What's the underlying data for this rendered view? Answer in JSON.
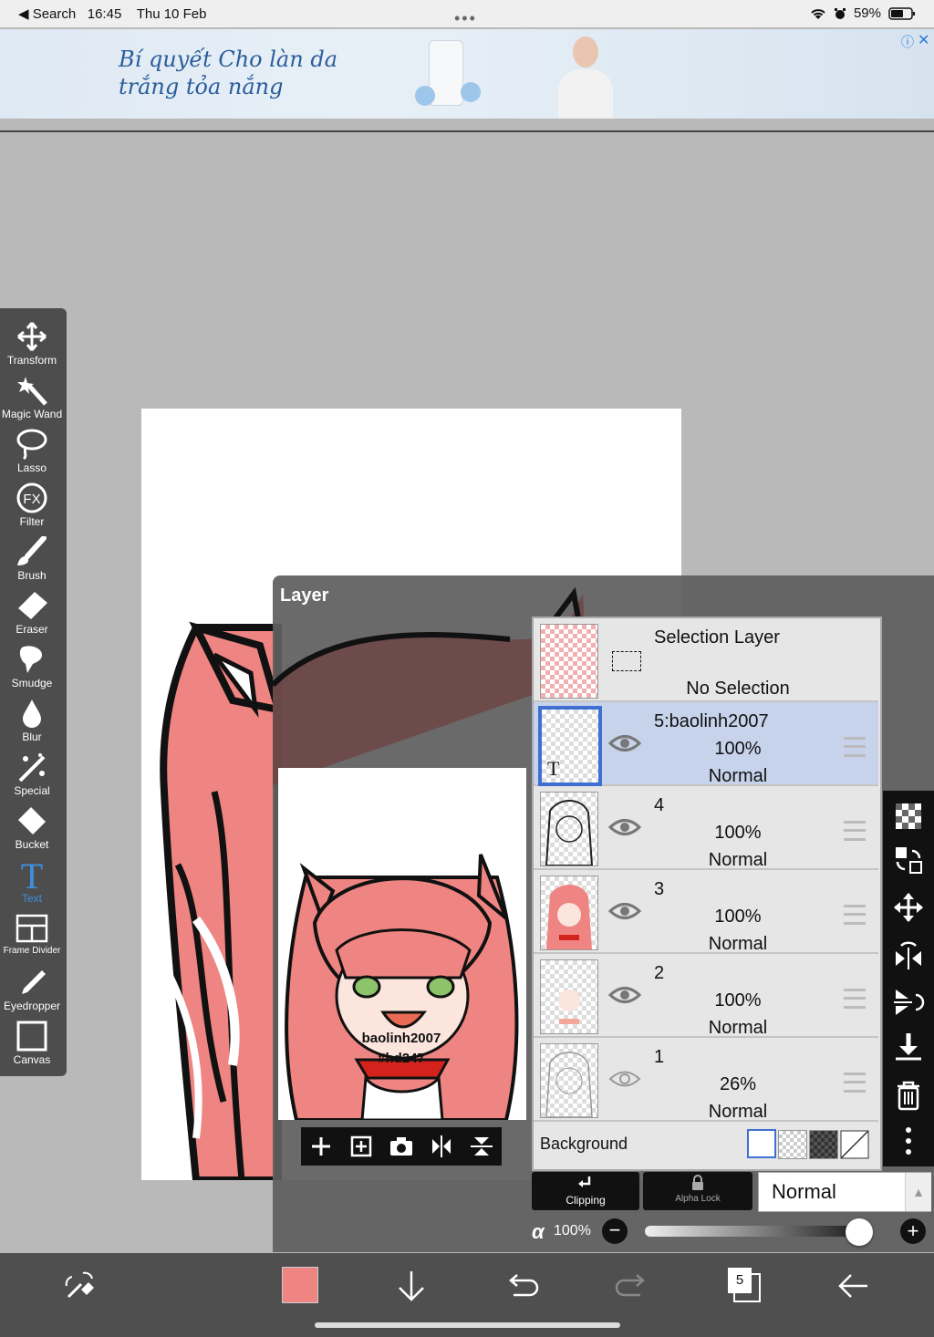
{
  "status_bar": {
    "back_label": "◀ Search",
    "time": "16:45",
    "date": "Thu 10 Feb",
    "battery": "59%"
  },
  "ad": {
    "text": "Bí quyết Cho làn da trắng tỏa nắng"
  },
  "tools": [
    {
      "label": "Transform",
      "icon": "transform-icon"
    },
    {
      "label": "Magic Wand",
      "icon": "magic-wand-icon"
    },
    {
      "label": "Lasso",
      "icon": "lasso-icon"
    },
    {
      "label": "Filter",
      "icon": "filter-icon"
    },
    {
      "label": "Brush",
      "icon": "brush-icon"
    },
    {
      "label": "Eraser",
      "icon": "eraser-icon"
    },
    {
      "label": "Smudge",
      "icon": "smudge-icon"
    },
    {
      "label": "Blur",
      "icon": "blur-icon"
    },
    {
      "label": "Special",
      "icon": "special-icon"
    },
    {
      "label": "Bucket",
      "icon": "bucket-icon"
    },
    {
      "label": "Text",
      "icon": "text-icon",
      "active": true
    },
    {
      "label": "Frame Divider",
      "icon": "frame-divider-icon"
    },
    {
      "label": "Eyedropper",
      "icon": "eyedropper-icon"
    },
    {
      "label": "Canvas",
      "icon": "canvas-icon"
    }
  ],
  "layer_panel": {
    "title": "Layer",
    "watermark_line1": "baolinh2007",
    "watermark_line2": "#hd247",
    "selection_layer": {
      "name": "Selection Layer",
      "status": "No Selection"
    },
    "layers": [
      {
        "name": "5:baolinh2007",
        "opacity": "100%",
        "mode": "Normal",
        "selected": true,
        "visible": true
      },
      {
        "name": "4",
        "opacity": "100%",
        "mode": "Normal",
        "selected": false,
        "visible": true
      },
      {
        "name": "3",
        "opacity": "100%",
        "mode": "Normal",
        "selected": false,
        "visible": true
      },
      {
        "name": "2",
        "opacity": "100%",
        "mode": "Normal",
        "selected": false,
        "visible": true
      },
      {
        "name": "1",
        "opacity": "26%",
        "mode": "Normal",
        "selected": false,
        "visible": false
      }
    ],
    "background_label": "Background",
    "clipping_label": "Clipping",
    "alpha_lock_label": "Alpha Lock",
    "blend_mode": "Normal",
    "alpha_symbol": "α",
    "opacity_value": "100%",
    "opacity_fraction": 1.0,
    "layer_count": "5"
  },
  "colors": {
    "current_color": "#ef8582",
    "selected_row": "#c6d3ea",
    "accent_blue": "#3f6fd1"
  }
}
